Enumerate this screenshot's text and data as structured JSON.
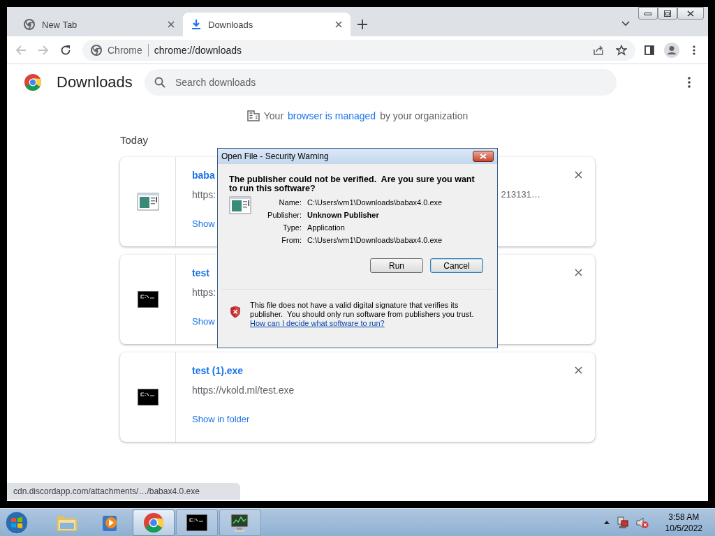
{
  "tabs": [
    {
      "label": "New Tab",
      "kind": "chrome",
      "selected": false
    },
    {
      "label": "Downloads",
      "kind": "download",
      "selected": true
    }
  ],
  "omnibox": {
    "chip": "Chrome",
    "url": "chrome://downloads"
  },
  "page": {
    "title": "Downloads",
    "search": {
      "placeholder": "Search downloads"
    },
    "managed": {
      "before": "Your",
      "link": "browser is managed",
      "after": "by your organization"
    },
    "section": "Today",
    "downloads": [
      {
        "name": "baba",
        "url": "https:",
        "url_tail": "213131…",
        "action": "Show",
        "kind": "app"
      },
      {
        "name": "test",
        "url": "https:",
        "action": "Show",
        "kind": "console"
      },
      {
        "name": "test (1).exe",
        "url": "https://vkold.ml/test.exe",
        "action": "Show in folder",
        "kind": "console"
      }
    ]
  },
  "dialog": {
    "title": "Open File - Security Warning",
    "heading": "The publisher could not be verified.  Are you sure you want to run this software?",
    "fields": [
      {
        "label": "Name:",
        "value": "C:\\Users\\vm1\\Downloads\\babax4.0.exe",
        "bold": false
      },
      {
        "label": "Publisher:",
        "value": "Unknown Publisher",
        "bold": true
      },
      {
        "label": "Type:",
        "value": "Application",
        "bold": false
      },
      {
        "label": "From:",
        "value": "C:\\Users\\vm1\\Downloads\\babax4.0.exe",
        "bold": false
      }
    ],
    "buttons": [
      {
        "label": "Run",
        "focused": false
      },
      {
        "label": "Cancel",
        "focused": true
      }
    ],
    "warning": "This file does not have a valid digital signature that verifies its publisher.  You should only run software from publishers you trust.",
    "help_link": "How can I decide what software to run?"
  },
  "status_bubble": "cdn.discordapp.com/attachments/…/babax4.0.exe",
  "taskbar": {
    "items": [
      {
        "kind": "folder",
        "active": false
      },
      {
        "kind": "media",
        "active": false
      },
      {
        "kind": "chrome",
        "active": true
      },
      {
        "kind": "console",
        "active": false
      },
      {
        "kind": "monitor",
        "active": false
      }
    ],
    "time": "3:58 AM",
    "date": "10/5/2022"
  }
}
